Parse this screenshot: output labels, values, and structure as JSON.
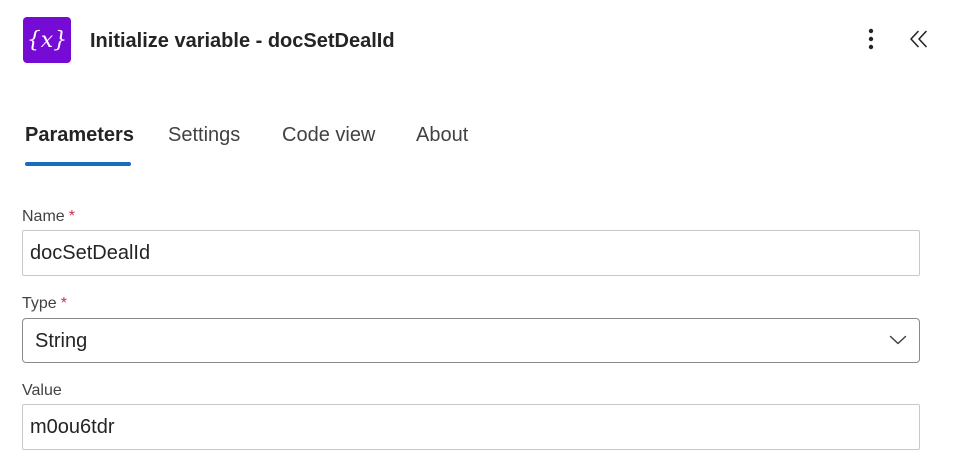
{
  "header": {
    "icon": "variable-icon",
    "title": "Initialize variable - docSetDealId",
    "more_icon": "more-vertical-icon",
    "collapse_icon": "double-chevron-left-icon"
  },
  "tabs": [
    {
      "label": "Parameters",
      "active": true
    },
    {
      "label": "Settings",
      "active": false
    },
    {
      "label": "Code view",
      "active": false
    },
    {
      "label": "About",
      "active": false
    }
  ],
  "form": {
    "name": {
      "label": "Name",
      "required_mark": "*",
      "value": "docSetDealId"
    },
    "type": {
      "label": "Type",
      "required_mark": "*",
      "value": "String"
    },
    "value": {
      "label": "Value",
      "value": "m0ou6tdr"
    }
  },
  "colors": {
    "icon_background": "#770bd6",
    "tab_indicator": "#1a6bbf",
    "required": "#c4314b"
  }
}
